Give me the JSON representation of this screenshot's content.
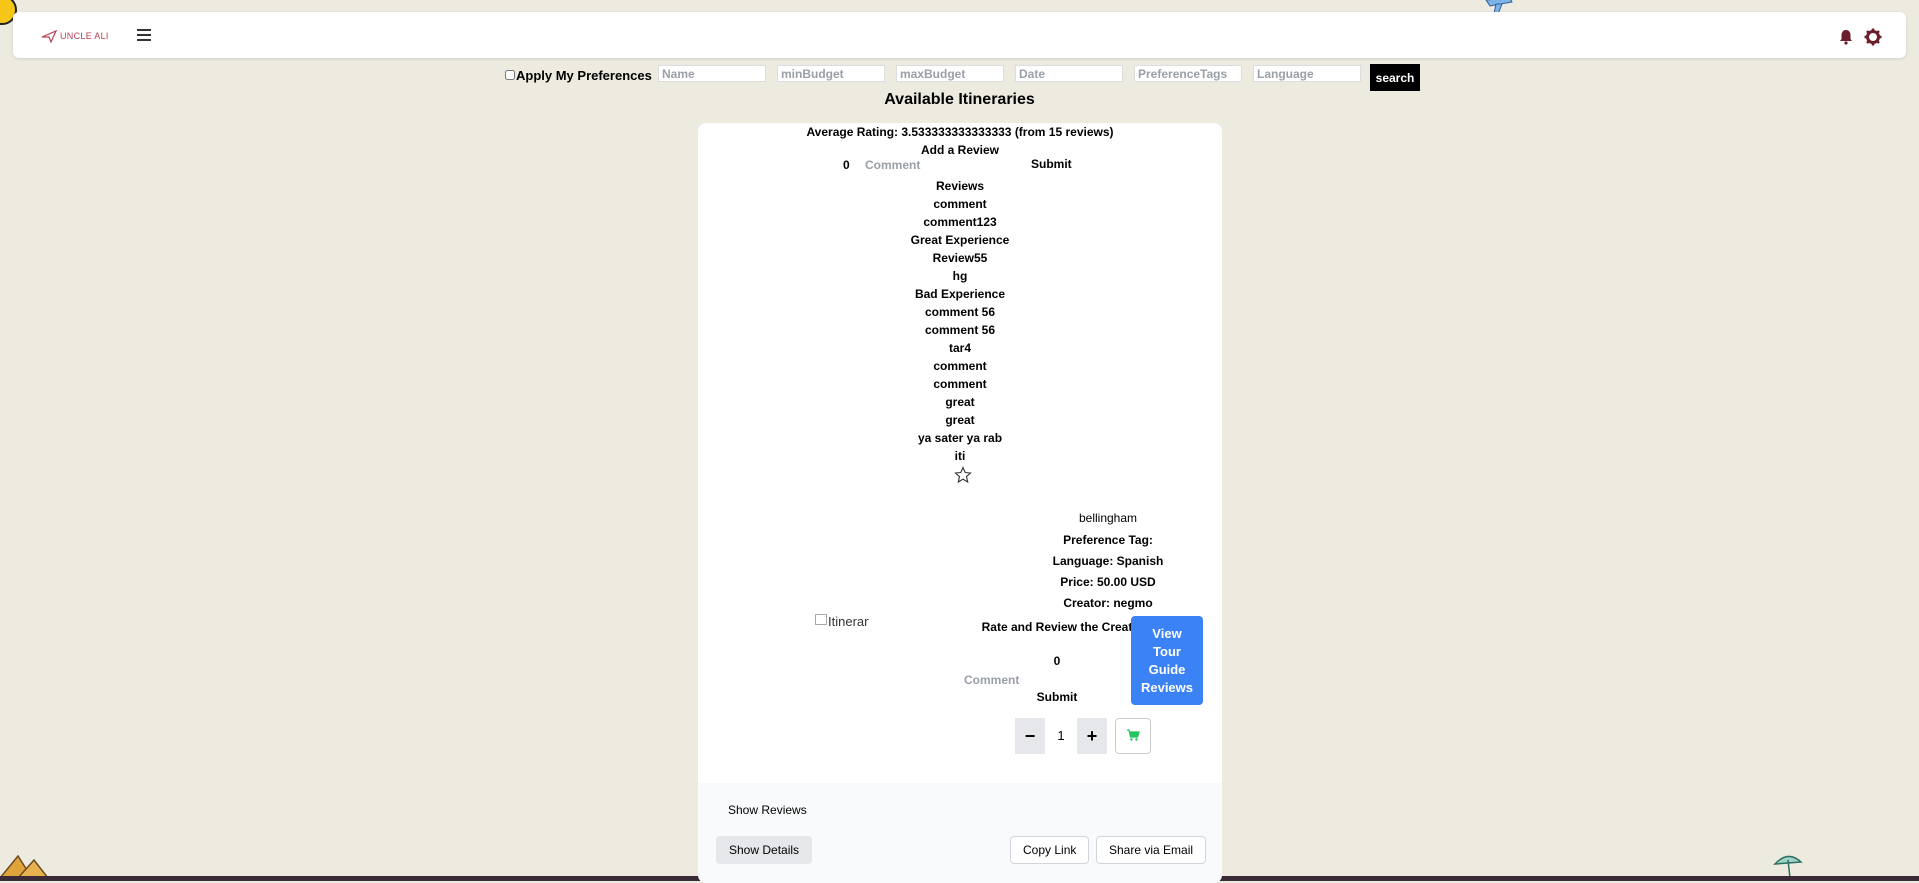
{
  "navbar": {
    "logo_text": "UNCLE ALI",
    "menu_icon": "hamburger-icon",
    "notification_icon": "bell-icon",
    "settings_icon": "gear-icon"
  },
  "filters": {
    "apply_preferences_label": "Apply My Preferences",
    "name_placeholder": "Name",
    "min_budget_placeholder": "minBudget",
    "max_budget_placeholder": "maxBudget",
    "date_placeholder": "Date",
    "preference_tags_placeholder": "PreferenceTags",
    "language_placeholder": "Language",
    "search_label": "search"
  },
  "page": {
    "title": "Available Itineraries"
  },
  "itinerary": {
    "average_rating": "Average Rating: 3.533333333333333 (from 15 reviews)",
    "add_review_title": "Add a Review",
    "review_rating_value": "0",
    "review_comment_placeholder": "Comment",
    "review_submit_label": "Submit",
    "reviews_heading": "Reviews",
    "reviews": [
      "comment",
      "comment123",
      "Great Experience",
      "Review55",
      "hg",
      "Bad Experience",
      "comment 56",
      "comment 56",
      "tar4",
      "comment",
      "comment",
      "great",
      "great",
      "ya sater ya rab",
      "iti"
    ],
    "image_alt": "Itinerary",
    "name": "bellingham",
    "preference_tag": "Preference Tag:",
    "language": "Language: Spanish",
    "price": "Price: 50.00 USD",
    "creator": "Creator: negmo",
    "rate_creator_title": "Rate and Review the Creator",
    "creator_rating_value": "0",
    "creator_comment_placeholder": "Comment",
    "creator_submit_label": "Submit",
    "view_reviews_label": "View Tour Guide Reviews",
    "quantity": "1",
    "decrement_label": "−",
    "increment_label": "+",
    "cart_icon": "cart-icon",
    "show_reviews_label": "Show Reviews",
    "show_details_label": "Show Details",
    "copy_link_label": "Copy Link",
    "share_email_label": "Share via Email"
  },
  "colors": {
    "background": "#edebe0",
    "primary_button": "#3b82f6",
    "search_button": "#000000",
    "brand": "#b5404f",
    "cart": "#22c55e"
  }
}
